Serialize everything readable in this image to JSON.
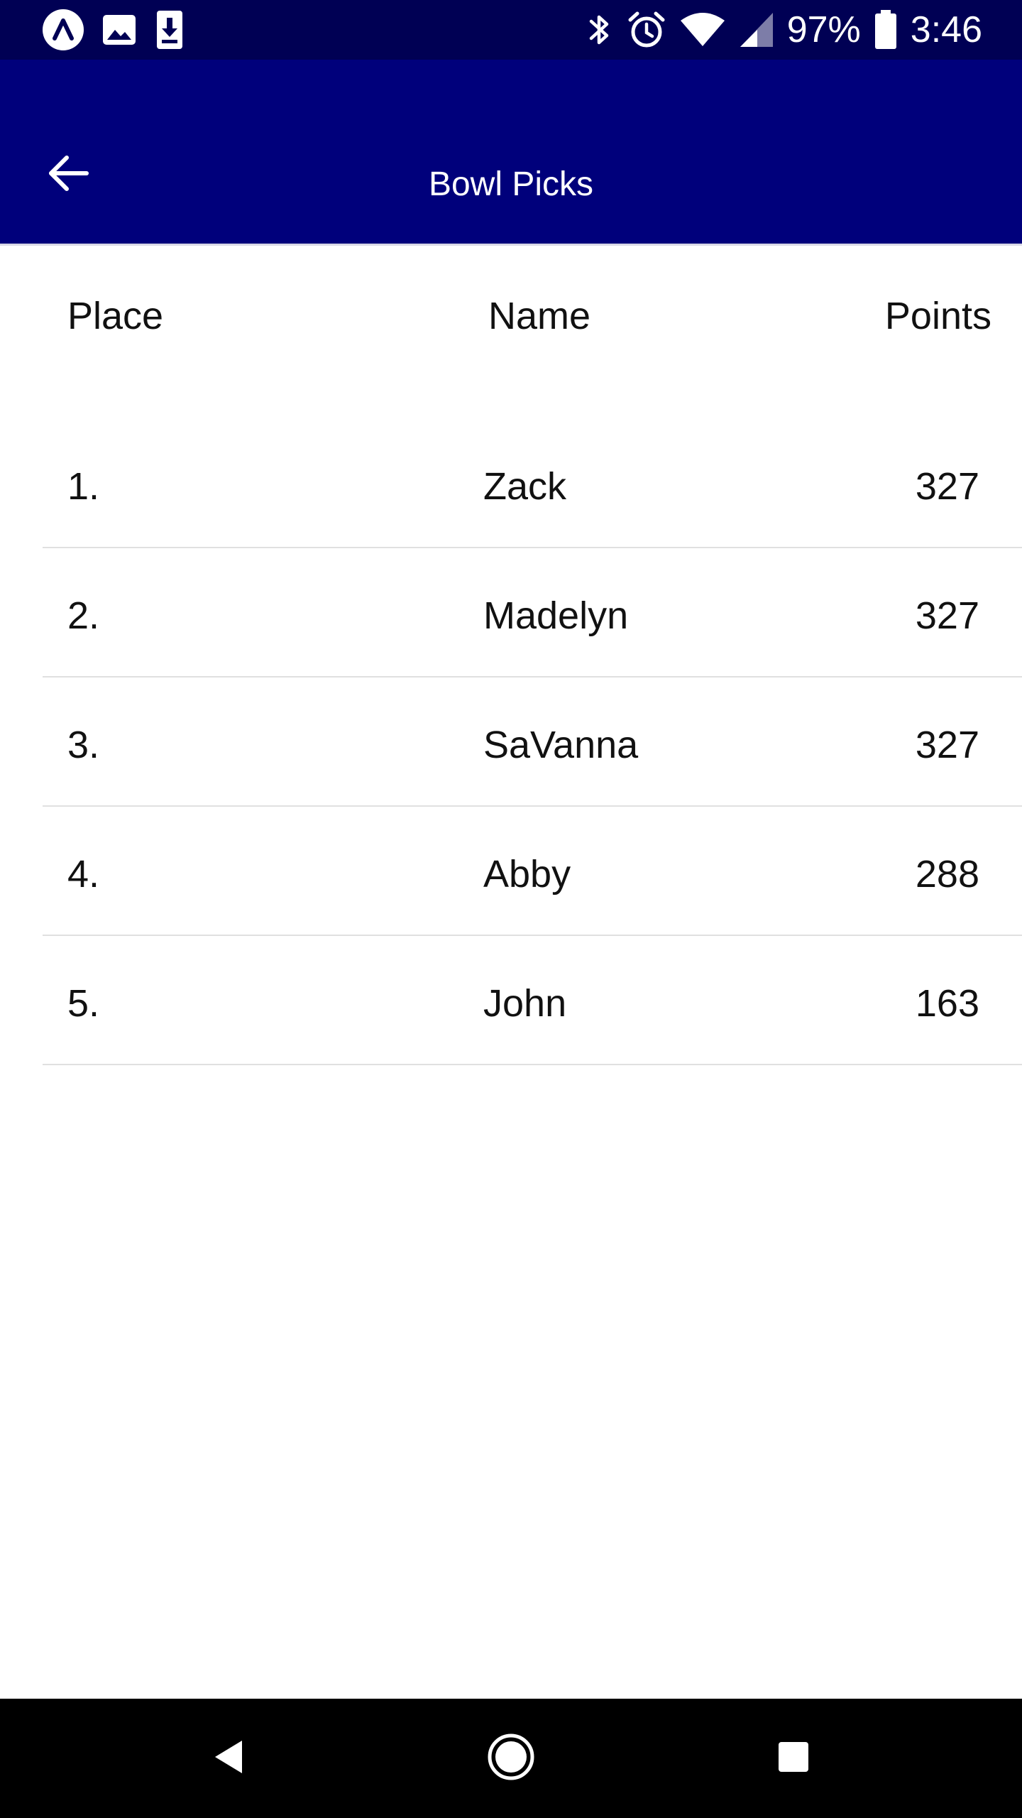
{
  "status_bar": {
    "battery_percent": "97%",
    "time": "3:46",
    "left_icons": [
      "app-notification-icon",
      "image-icon",
      "download-icon"
    ],
    "right_icons": [
      "bluetooth-icon",
      "alarm-icon",
      "wifi-icon",
      "cell-signal-icon",
      "battery-icon"
    ]
  },
  "app_bar": {
    "title": "Bowl Picks",
    "back_icon": "arrow-back-icon",
    "color": "#00007b"
  },
  "table": {
    "headers": {
      "place": "Place",
      "name": "Name",
      "points": "Points"
    },
    "rows": [
      {
        "place": "1.",
        "name": "Zack",
        "points": "327"
      },
      {
        "place": "2.",
        "name": "Madelyn",
        "points": "327"
      },
      {
        "place": "3.",
        "name": "SaVanna",
        "points": "327"
      },
      {
        "place": "4.",
        "name": "Abby",
        "points": "288"
      },
      {
        "place": "5.",
        "name": "John",
        "points": "163"
      }
    ]
  },
  "nav_bar": {
    "icons": [
      "nav-back-icon",
      "nav-home-icon",
      "nav-recents-icon"
    ]
  }
}
